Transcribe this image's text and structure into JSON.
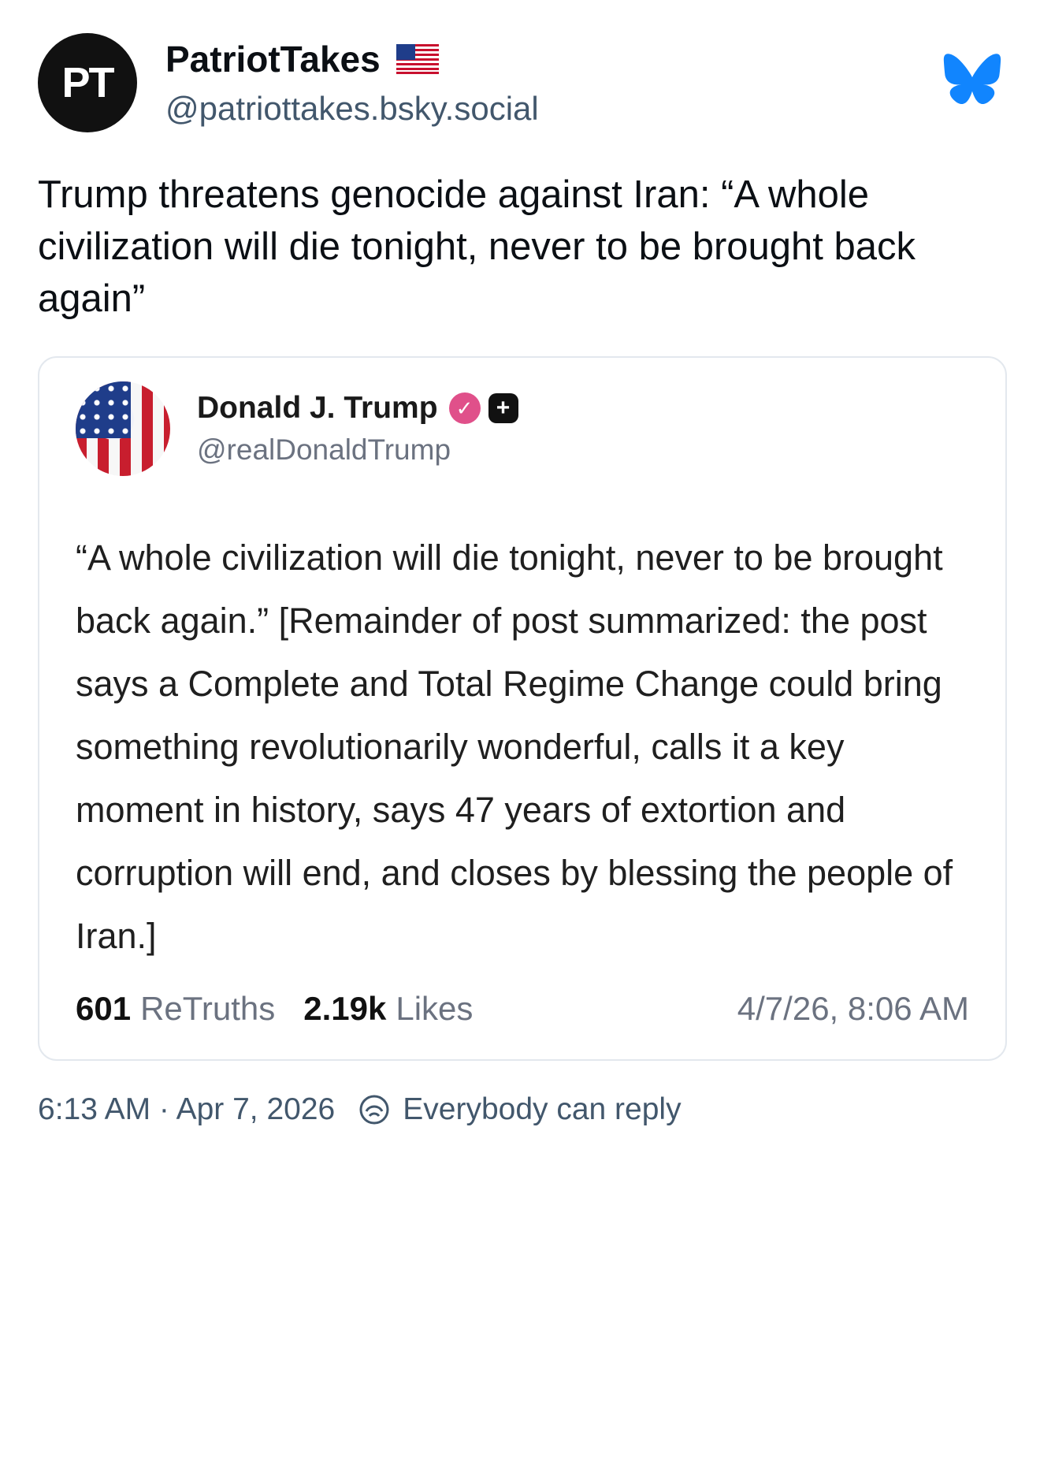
{
  "post": {
    "avatar_text": "PT",
    "display_name": "PatriotTakes",
    "flag_icon": "us-flag-icon",
    "handle": "@patriottakes.bsky.social",
    "app_icon": "bluesky-butterfly-icon",
    "text": "Trump threatens genocide against Iran: “A whole civilization will die tonight, never to be brought back again”"
  },
  "quote": {
    "display_name": "Donald J. Trump",
    "verified_icon": "verified-badge-icon",
    "plus_icon": "plus-badge-icon",
    "handle": "@realDonaldTrump",
    "body": "“A whole civilization will die tonight, never to be brought back again.” [Remainder of post summarized: the post says a Complete and Total Regime Change could bring something revolutionarily wonderful, calls it a key moment in history, says 47 years of extortion and corruption will end, and closes by blessing the people of Iran.]",
    "retruths_count": "601",
    "retruths_label": "ReTruths",
    "likes_count": "2.19k",
    "likes_label": "Likes",
    "timestamp": "4/7/26, 8:06 AM"
  },
  "footer": {
    "timestamp": "6:13 AM · Apr 7, 2026",
    "reply_icon": "reply-settings-icon",
    "reply_setting": "Everybody can reply"
  },
  "colors": {
    "text": "#0b0f14",
    "muted": "#42576c",
    "bluesky_blue": "#1185fe",
    "card_border": "#e3e8ee",
    "verified_pink": "#e0508a"
  }
}
